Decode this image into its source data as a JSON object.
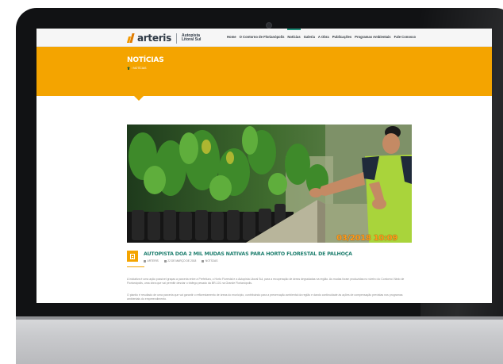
{
  "site": {
    "logo_text": "arteris",
    "logo_sub_line1": "Autopista",
    "logo_sub_line2": "Litoral Sul"
  },
  "nav": {
    "items": [
      {
        "label": "Home"
      },
      {
        "label": "O Contorno de Florianópolis"
      },
      {
        "label": "Notícias"
      },
      {
        "label": "Galeria"
      },
      {
        "label": "A Obra"
      },
      {
        "label": "Publicações"
      },
      {
        "label": "Programas Ambientais"
      },
      {
        "label": "Fale Conosco"
      }
    ],
    "active": "Notícias"
  },
  "banner": {
    "title": "NOTÍCIAS",
    "breadcrumb": "/ NOTÍCIAS",
    "color": "#f4a400"
  },
  "photo": {
    "timestamp": "03/2018 10:09"
  },
  "post": {
    "title": "AUTOPISTA DOA 2 MIL MUDAS NATIVAS PARA HORTO FLORESTAL DE PALHOÇA",
    "meta_author": "ARTERIS",
    "meta_date": "22 DE MARÇO DE 2018",
    "meta_category": "NOTÍCIAS",
    "paragraph1": "A iniciativa é uma ação possível graças a parceria entre a Prefeitura, o Horto Florestal e a Autopista Litoral Sul, para a recuperação de áreas degradadas na região. As mudas foram produzidas no viveiro do Contorno Viário de Florianópolis, uma obra que vai permitir desviar o tráfego pesado da BR-101 na Grande Florianópolis.",
    "paragraph2": "O plantio é resultado de uma parceria que vai garantir o reflorestamento de áreas do município, contribuindo para a preservação ambiental da região e dando continuidade às ações de compensação previstas nos programas ambientais do empreendimento."
  },
  "colors": {
    "accent": "#f4a400",
    "title_green": "#1f7f6f",
    "nav_active": "#1f8f7a"
  }
}
